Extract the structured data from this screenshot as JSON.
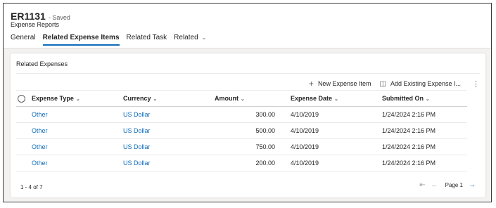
{
  "record": {
    "title": "ER1131",
    "status": "- Saved",
    "entity": "Expense Reports"
  },
  "tabs": [
    {
      "label": "General"
    },
    {
      "label": "Related Expense Items"
    },
    {
      "label": "Related Task"
    },
    {
      "label": "Related"
    }
  ],
  "section": {
    "title": "Related Expenses"
  },
  "toolbar": {
    "new_label": "New Expense Item",
    "add_existing_label": "Add Existing Expense I..."
  },
  "grid": {
    "columns": {
      "type": "Expense Type",
      "currency": "Currency",
      "amount": "Amount",
      "date": "Expense Date",
      "submitted": "Submitted On"
    },
    "rows": [
      {
        "type": "Other",
        "currency": "US Dollar",
        "amount": "300.00",
        "date": "4/10/2019",
        "submitted": "1/24/2024 2:16 PM"
      },
      {
        "type": "Other",
        "currency": "US Dollar",
        "amount": "500.00",
        "date": "4/10/2019",
        "submitted": "1/24/2024 2:16 PM"
      },
      {
        "type": "Other",
        "currency": "US Dollar",
        "amount": "750.00",
        "date": "4/10/2019",
        "submitted": "1/24/2024 2:16 PM"
      },
      {
        "type": "Other",
        "currency": "US Dollar",
        "amount": "200.00",
        "date": "4/10/2019",
        "submitted": "1/24/2024 2:16 PM"
      }
    ]
  },
  "footer": {
    "count": "1 - 4 of 7",
    "page": "Page 1"
  },
  "colors": {
    "accent": "#0f6cbd"
  }
}
